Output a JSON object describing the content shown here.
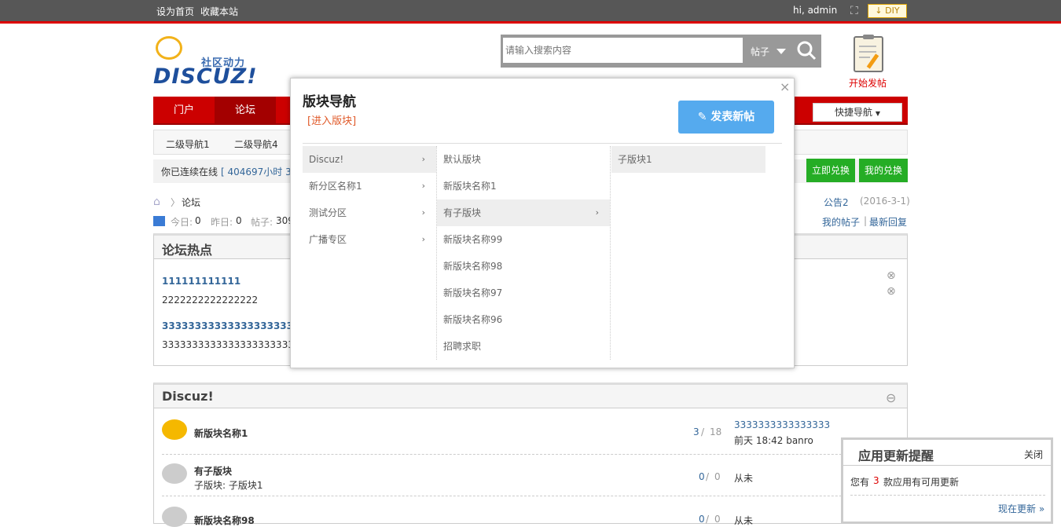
{
  "topbar": {
    "set_home": "设为首页",
    "bookmark": "收藏本站",
    "greeting": "hi, admin",
    "diy_label": "DIY",
    "sitemap_icon": "sitemap-icon"
  },
  "logo": {
    "sub": "社区动力",
    "main": "DISCUZ!"
  },
  "search": {
    "placeholder": "请输入搜索内容",
    "type_label": "帖子",
    "icon": "search-icon"
  },
  "post": {
    "label": "开始发帖",
    "icon": "clipboard-pen-icon"
  },
  "nav": {
    "items": [
      "门户",
      "论坛"
    ],
    "quick_label": "快捷导航"
  },
  "subnav": {
    "items": [
      "二级导航1",
      "二级导航4"
    ]
  },
  "online": {
    "text": "你已连续在线",
    "hours": "[ 404697小时 39"
  },
  "buttons": {
    "exchange": "立即兑换",
    "my_exchange": "我的兑换"
  },
  "breadcrumb": {
    "current": "论坛",
    "separator": "〉"
  },
  "stats": {
    "today_label": "今日:",
    "today": "0",
    "yesterday_label": "昨日:",
    "yesterday": "0",
    "posts_label": "帖子:",
    "posts": "309"
  },
  "announce": {
    "title": "公告2",
    "date": "(2016-3-1)"
  },
  "links": {
    "my_posts": "我的帖子",
    "latest": "最新回复"
  },
  "hot": {
    "title": "论坛热点",
    "items": [
      {
        "title": "111111111111",
        "desc": "2222222222222222"
      },
      {
        "title": "333333333333333333333",
        "desc": "33333333333333333333333"
      }
    ]
  },
  "discuz": {
    "title": "Discuz!",
    "forums": [
      {
        "name": "新版块名称1",
        "sub": "",
        "stats": "3",
        "total": "18",
        "last_title": "3333333333333333",
        "last_time": "前天 18:42 banro"
      },
      {
        "name": "有子版块",
        "sub": "子版块: 子版块1",
        "stats": "0",
        "total": "0",
        "last_title": "",
        "last_time": "从未"
      },
      {
        "name": "新版块名称98",
        "sub": "",
        "stats": "0",
        "total": "0",
        "last_title": "",
        "last_time": "从未"
      }
    ]
  },
  "popup": {
    "title": "版块导航",
    "enter": "[进入版块]",
    "new_post": "发表新帖",
    "close": "×",
    "col1": [
      "Discuz!",
      "新分区名称1",
      "测试分区",
      "广播专区"
    ],
    "col2": [
      "默认版块",
      "新版块名称1",
      "有子版块",
      "新版块名称99",
      "新版块名称98",
      "新版块名称97",
      "新版块名称96",
      "招聘求职"
    ],
    "col3": [
      "子版块1"
    ]
  },
  "update": {
    "title": "应用更新提醒",
    "close": "关闭",
    "text_pre": "您有",
    "count": "3",
    "text_post": "款应用有可用更新",
    "link": "现在更新 »"
  },
  "colors": {
    "accent": "#cc0000",
    "green": "#25ad25",
    "popup_btn": "#55aaee"
  }
}
